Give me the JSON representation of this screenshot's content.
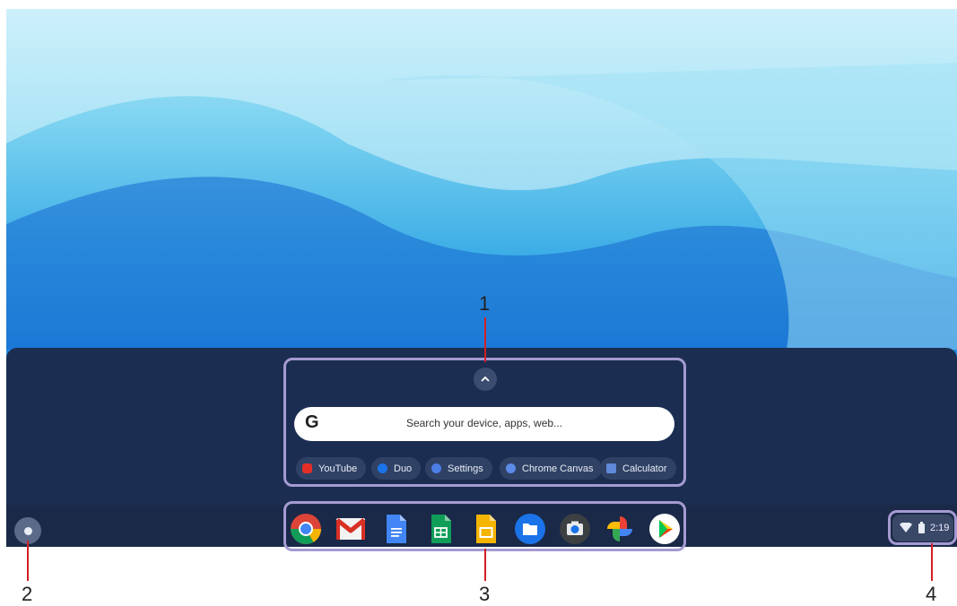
{
  "callouts": {
    "n1": "1",
    "n2": "2",
    "n3": "3",
    "n4": "4"
  },
  "launcher": {
    "expand_icon": "chevron-up-icon",
    "search": {
      "logo": "G",
      "placeholder": "Search your device, apps, web..."
    },
    "suggestions": [
      {
        "label": "YouTube",
        "icon": "youtube-icon",
        "color": "#e52d27"
      },
      {
        "label": "Duo",
        "icon": "duo-icon",
        "color": "#1a73e8"
      },
      {
        "label": "Settings",
        "icon": "settings-icon",
        "color": "#4d7ee8"
      },
      {
        "label": "Chrome Canvas",
        "icon": "chrome-canvas-icon",
        "color": "#5b8be6"
      },
      {
        "label": "Calculator",
        "icon": "calculator-icon",
        "color": "#5f89d8"
      }
    ]
  },
  "shelf": {
    "launcher_button": "launcher-circle-icon",
    "apps": [
      {
        "name": "Chrome",
        "icon": "chrome-icon"
      },
      {
        "name": "Gmail",
        "icon": "gmail-icon"
      },
      {
        "name": "Docs",
        "icon": "docs-icon"
      },
      {
        "name": "Sheets",
        "icon": "sheets-icon"
      },
      {
        "name": "Slides",
        "icon": "slides-icon"
      },
      {
        "name": "Files",
        "icon": "files-icon"
      },
      {
        "name": "Camera",
        "icon": "camera-icon"
      },
      {
        "name": "Photos",
        "icon": "photos-icon"
      },
      {
        "name": "Play Store",
        "icon": "play-store-icon"
      }
    ],
    "tray": {
      "time": "2:19",
      "wifi_icon": "wifi-icon",
      "battery_icon": "battery-icon"
    }
  }
}
